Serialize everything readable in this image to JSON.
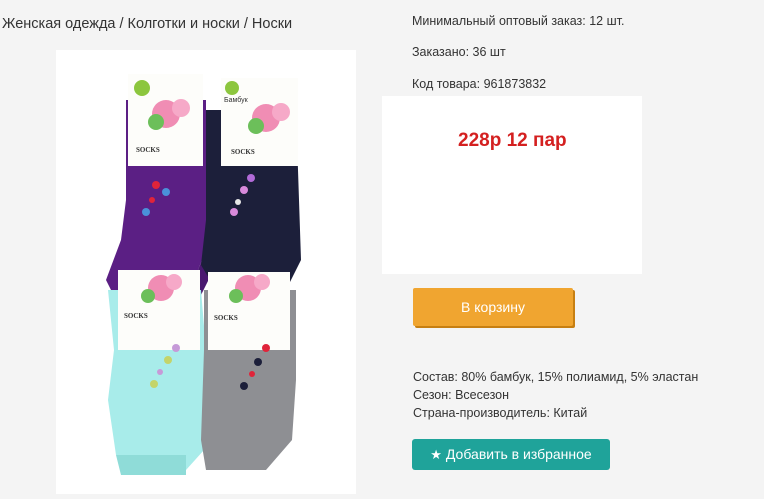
{
  "breadcrumb": {
    "items": [
      "Женская одежда",
      "Колготки и носки",
      "Носки"
    ],
    "separator": "/"
  },
  "product": {
    "min_order": "Минимальный оптовый заказ: 12 шт.",
    "ordered": "Заказано: 36 шт",
    "code": "Код товара: 961873832",
    "price": "228р 12 пар",
    "package_brand": "Бамбук",
    "package_label": "SOCKS"
  },
  "buttons": {
    "cart": "В корзину",
    "favorite": "Добавить в избранное"
  },
  "specs": {
    "composition": "Состав: 80% бамбук, 15% полиамид, 5% эластан",
    "season": "Сезон: Всесезон",
    "country": "Страна-производитель: Китай"
  },
  "colors": {
    "price": "#d42020",
    "cart_button": "#f0a530",
    "favorite_button": "#1fa39a",
    "sock_purple": "#5b1f84",
    "sock_navy": "#1c1f3a",
    "sock_mint": "#a8ecea",
    "sock_gray": "#8e8f93"
  },
  "icons": {
    "favorite": "star-icon"
  }
}
